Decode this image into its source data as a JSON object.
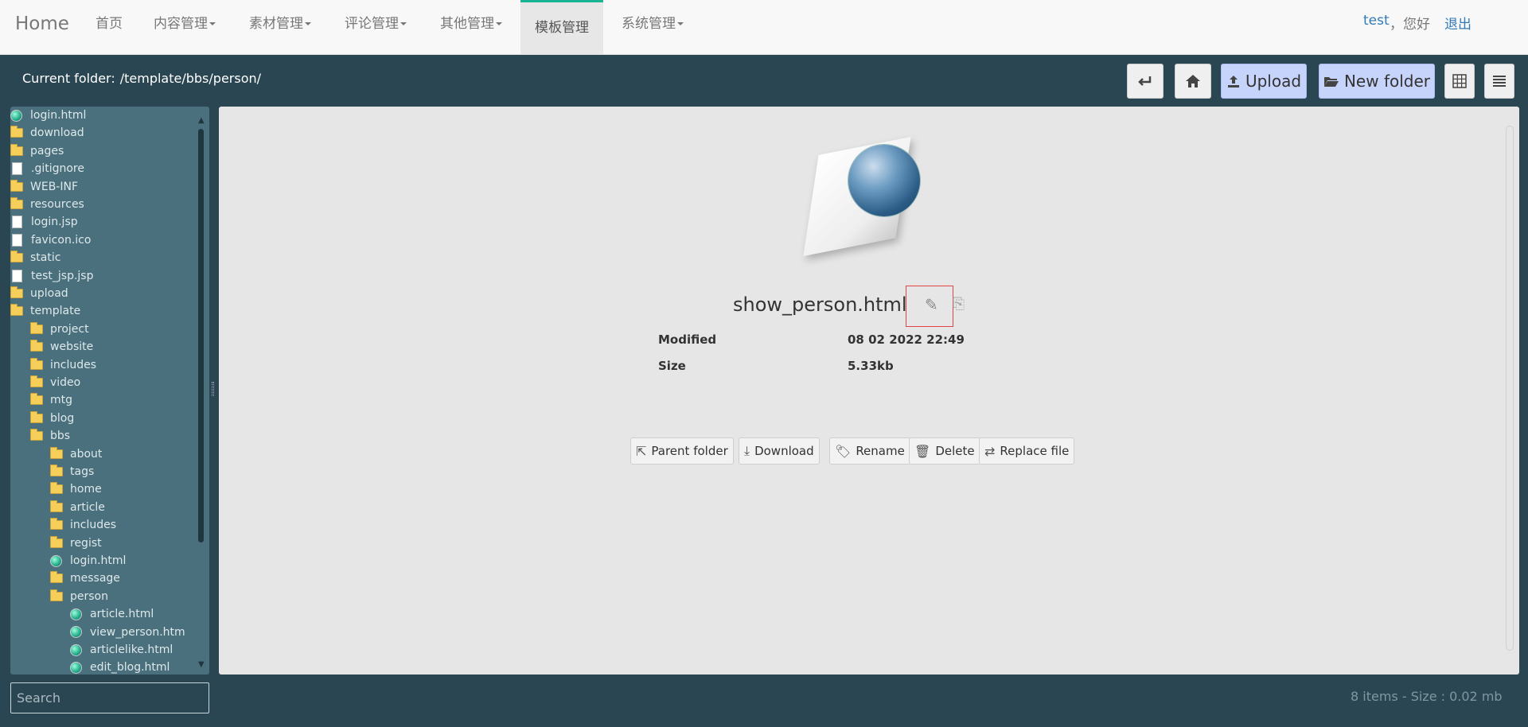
{
  "nav": {
    "brand": "Home",
    "items": [
      {
        "label": "首页",
        "caret": false
      },
      {
        "label": "内容管理",
        "caret": true
      },
      {
        "label": "素材管理",
        "caret": true
      },
      {
        "label": "评论管理",
        "caret": true
      },
      {
        "label": "其他管理",
        "caret": true
      },
      {
        "label": "模板管理",
        "caret": false,
        "active": true
      },
      {
        "label": "系统管理",
        "caret": true
      }
    ],
    "user": "test",
    "hello": "，您好",
    "logout": "退出"
  },
  "toolbar": {
    "folder_label": "Current folder:",
    "folder_path": "/template/bbs/person/",
    "back_icon": "enter-back-icon",
    "home_icon": "home-icon",
    "upload_label": "Upload",
    "new_folder_label": "New folder",
    "grid_icon": "grid-view-icon",
    "list_icon": "list-view-icon"
  },
  "tree": [
    {
      "name": "login.html",
      "type": "html",
      "level": 0
    },
    {
      "name": "download",
      "type": "folder",
      "level": 0
    },
    {
      "name": "pages",
      "type": "folder",
      "level": 0
    },
    {
      "name": ".gitignore",
      "type": "file",
      "level": 0
    },
    {
      "name": "WEB-INF",
      "type": "folder",
      "level": 0
    },
    {
      "name": "resources",
      "type": "folder",
      "level": 0
    },
    {
      "name": "login.jsp",
      "type": "file",
      "level": 0
    },
    {
      "name": "favicon.ico",
      "type": "file",
      "level": 0
    },
    {
      "name": "static",
      "type": "folder",
      "level": 0
    },
    {
      "name": "test_jsp.jsp",
      "type": "file",
      "level": 0
    },
    {
      "name": "upload",
      "type": "folder",
      "level": 0
    },
    {
      "name": "template",
      "type": "folder",
      "level": 0
    },
    {
      "name": "project",
      "type": "folder",
      "level": 1
    },
    {
      "name": "website",
      "type": "folder",
      "level": 1
    },
    {
      "name": "includes",
      "type": "folder",
      "level": 1
    },
    {
      "name": "video",
      "type": "folder",
      "level": 1
    },
    {
      "name": "mtg",
      "type": "folder",
      "level": 1
    },
    {
      "name": "blog",
      "type": "folder",
      "level": 1
    },
    {
      "name": "bbs",
      "type": "folder",
      "level": 1
    },
    {
      "name": "about",
      "type": "folder",
      "level": 2
    },
    {
      "name": "tags",
      "type": "folder",
      "level": 2
    },
    {
      "name": "home",
      "type": "folder",
      "level": 2
    },
    {
      "name": "article",
      "type": "folder",
      "level": 2
    },
    {
      "name": "includes",
      "type": "folder",
      "level": 2
    },
    {
      "name": "regist",
      "type": "folder",
      "level": 2
    },
    {
      "name": "login.html",
      "type": "html",
      "level": 2
    },
    {
      "name": "message",
      "type": "folder",
      "level": 2
    },
    {
      "name": "person",
      "type": "folder",
      "level": 2
    },
    {
      "name": "article.html",
      "type": "html",
      "level": 3
    },
    {
      "name": "view_person.htm",
      "type": "html",
      "level": 3
    },
    {
      "name": "articlelike.html",
      "type": "html",
      "level": 3
    },
    {
      "name": "edit_blog.html",
      "type": "html",
      "level": 3
    }
  ],
  "search": {
    "placeholder": "Search"
  },
  "file": {
    "name": "show_person.html",
    "modified_label": "Modified",
    "modified_value": "08 02 2022 22:49",
    "size_label": "Size",
    "size_value": "5.33kb"
  },
  "actions": [
    {
      "label": "Parent folder",
      "icon": "parent-folder-icon",
      "glyph": "⇱"
    },
    {
      "label": "Download",
      "icon": "download-icon",
      "glyph": "⤓"
    },
    {
      "label": "Rename",
      "icon": "tag-icon",
      "glyph": "🏷"
    },
    {
      "label": "Delete",
      "icon": "trash-icon",
      "glyph": "🗑"
    },
    {
      "label": "Replace file",
      "icon": "retweet-icon",
      "glyph": "⇄"
    }
  ],
  "status": "8 items - Size : 0.02 mb"
}
